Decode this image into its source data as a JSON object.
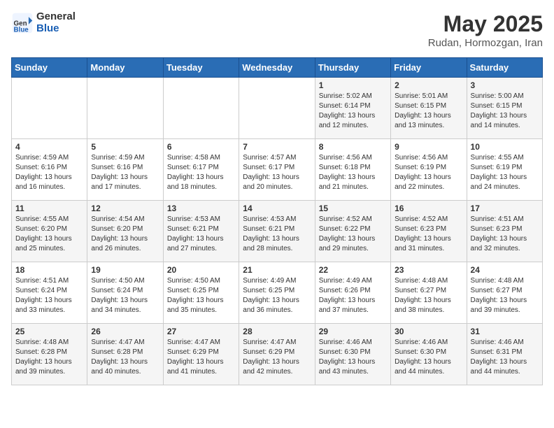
{
  "header": {
    "logo_general": "General",
    "logo_blue": "Blue",
    "title": "May 2025",
    "subtitle": "Rudan, Hormozgan, Iran"
  },
  "days_of_week": [
    "Sunday",
    "Monday",
    "Tuesday",
    "Wednesday",
    "Thursday",
    "Friday",
    "Saturday"
  ],
  "weeks": [
    [
      {
        "day": "",
        "info": ""
      },
      {
        "day": "",
        "info": ""
      },
      {
        "day": "",
        "info": ""
      },
      {
        "day": "",
        "info": ""
      },
      {
        "day": "1",
        "info": "Sunrise: 5:02 AM\nSunset: 6:14 PM\nDaylight: 13 hours\nand 12 minutes."
      },
      {
        "day": "2",
        "info": "Sunrise: 5:01 AM\nSunset: 6:15 PM\nDaylight: 13 hours\nand 13 minutes."
      },
      {
        "day": "3",
        "info": "Sunrise: 5:00 AM\nSunset: 6:15 PM\nDaylight: 13 hours\nand 14 minutes."
      }
    ],
    [
      {
        "day": "4",
        "info": "Sunrise: 4:59 AM\nSunset: 6:16 PM\nDaylight: 13 hours\nand 16 minutes."
      },
      {
        "day": "5",
        "info": "Sunrise: 4:59 AM\nSunset: 6:16 PM\nDaylight: 13 hours\nand 17 minutes."
      },
      {
        "day": "6",
        "info": "Sunrise: 4:58 AM\nSunset: 6:17 PM\nDaylight: 13 hours\nand 18 minutes."
      },
      {
        "day": "7",
        "info": "Sunrise: 4:57 AM\nSunset: 6:17 PM\nDaylight: 13 hours\nand 20 minutes."
      },
      {
        "day": "8",
        "info": "Sunrise: 4:56 AM\nSunset: 6:18 PM\nDaylight: 13 hours\nand 21 minutes."
      },
      {
        "day": "9",
        "info": "Sunrise: 4:56 AM\nSunset: 6:19 PM\nDaylight: 13 hours\nand 22 minutes."
      },
      {
        "day": "10",
        "info": "Sunrise: 4:55 AM\nSunset: 6:19 PM\nDaylight: 13 hours\nand 24 minutes."
      }
    ],
    [
      {
        "day": "11",
        "info": "Sunrise: 4:55 AM\nSunset: 6:20 PM\nDaylight: 13 hours\nand 25 minutes."
      },
      {
        "day": "12",
        "info": "Sunrise: 4:54 AM\nSunset: 6:20 PM\nDaylight: 13 hours\nand 26 minutes."
      },
      {
        "day": "13",
        "info": "Sunrise: 4:53 AM\nSunset: 6:21 PM\nDaylight: 13 hours\nand 27 minutes."
      },
      {
        "day": "14",
        "info": "Sunrise: 4:53 AM\nSunset: 6:21 PM\nDaylight: 13 hours\nand 28 minutes."
      },
      {
        "day": "15",
        "info": "Sunrise: 4:52 AM\nSunset: 6:22 PM\nDaylight: 13 hours\nand 29 minutes."
      },
      {
        "day": "16",
        "info": "Sunrise: 4:52 AM\nSunset: 6:23 PM\nDaylight: 13 hours\nand 31 minutes."
      },
      {
        "day": "17",
        "info": "Sunrise: 4:51 AM\nSunset: 6:23 PM\nDaylight: 13 hours\nand 32 minutes."
      }
    ],
    [
      {
        "day": "18",
        "info": "Sunrise: 4:51 AM\nSunset: 6:24 PM\nDaylight: 13 hours\nand 33 minutes."
      },
      {
        "day": "19",
        "info": "Sunrise: 4:50 AM\nSunset: 6:24 PM\nDaylight: 13 hours\nand 34 minutes."
      },
      {
        "day": "20",
        "info": "Sunrise: 4:50 AM\nSunset: 6:25 PM\nDaylight: 13 hours\nand 35 minutes."
      },
      {
        "day": "21",
        "info": "Sunrise: 4:49 AM\nSunset: 6:25 PM\nDaylight: 13 hours\nand 36 minutes."
      },
      {
        "day": "22",
        "info": "Sunrise: 4:49 AM\nSunset: 6:26 PM\nDaylight: 13 hours\nand 37 minutes."
      },
      {
        "day": "23",
        "info": "Sunrise: 4:48 AM\nSunset: 6:27 PM\nDaylight: 13 hours\nand 38 minutes."
      },
      {
        "day": "24",
        "info": "Sunrise: 4:48 AM\nSunset: 6:27 PM\nDaylight: 13 hours\nand 39 minutes."
      }
    ],
    [
      {
        "day": "25",
        "info": "Sunrise: 4:48 AM\nSunset: 6:28 PM\nDaylight: 13 hours\nand 39 minutes."
      },
      {
        "day": "26",
        "info": "Sunrise: 4:47 AM\nSunset: 6:28 PM\nDaylight: 13 hours\nand 40 minutes."
      },
      {
        "day": "27",
        "info": "Sunrise: 4:47 AM\nSunset: 6:29 PM\nDaylight: 13 hours\nand 41 minutes."
      },
      {
        "day": "28",
        "info": "Sunrise: 4:47 AM\nSunset: 6:29 PM\nDaylight: 13 hours\nand 42 minutes."
      },
      {
        "day": "29",
        "info": "Sunrise: 4:46 AM\nSunset: 6:30 PM\nDaylight: 13 hours\nand 43 minutes."
      },
      {
        "day": "30",
        "info": "Sunrise: 4:46 AM\nSunset: 6:30 PM\nDaylight: 13 hours\nand 44 minutes."
      },
      {
        "day": "31",
        "info": "Sunrise: 4:46 AM\nSunset: 6:31 PM\nDaylight: 13 hours\nand 44 minutes."
      }
    ]
  ]
}
